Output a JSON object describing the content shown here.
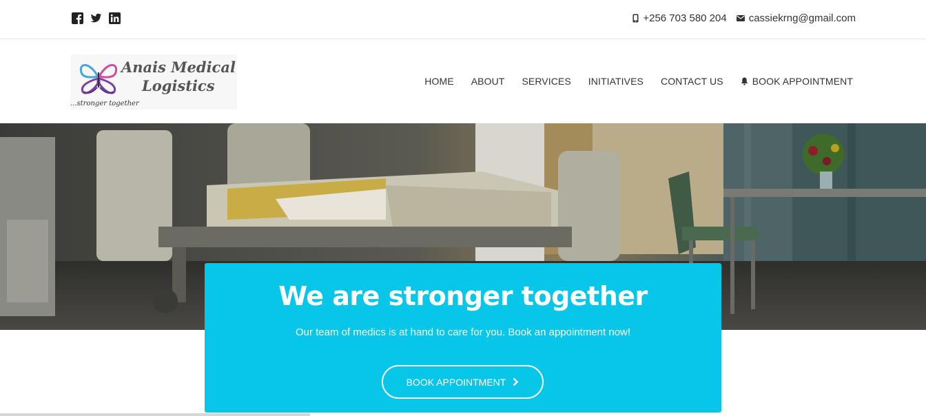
{
  "topbar": {
    "social": [
      {
        "icon": "facebook-icon"
      },
      {
        "icon": "twitter-icon"
      },
      {
        "icon": "linkedin-icon"
      }
    ],
    "phone": "+256 703 580 204",
    "email": "cassiekrng@gmail.com"
  },
  "logo": {
    "line1": "Anais Medical",
    "line2": "Logistics",
    "tagline": "...stronger together"
  },
  "nav": {
    "items": [
      "HOME",
      "ABOUT",
      "SERVICES",
      "INITIATIVES",
      "CONTACT US"
    ],
    "book": "BOOK APPOINTMENT"
  },
  "hero": {
    "image": "hospital-room-photo",
    "title": "We are stronger together",
    "subtitle": "Our team of medics is at hand to care for you. Book an appointment now!",
    "button": "BOOK APPOINTMENT"
  },
  "colors": {
    "accent": "#08c6e8",
    "text": "#333333"
  }
}
